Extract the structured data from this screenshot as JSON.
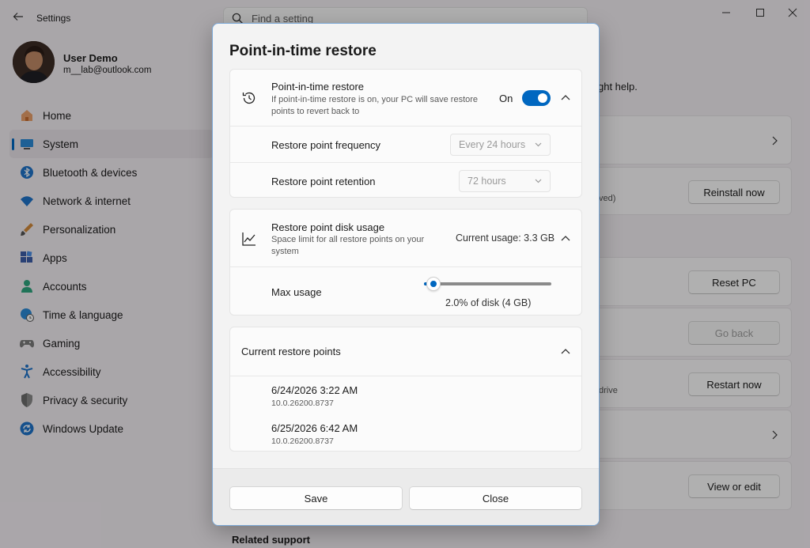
{
  "window": {
    "app_title": "Settings",
    "search_placeholder": "Find a setting"
  },
  "profile": {
    "name": "User Demo",
    "email": "m__lab@outlook.com"
  },
  "sidebar": {
    "items": [
      {
        "label": "Home",
        "icon": "home-icon"
      },
      {
        "label": "System",
        "icon": "system-icon",
        "active": true
      },
      {
        "label": "Bluetooth & devices",
        "icon": "bluetooth-icon"
      },
      {
        "label": "Network & internet",
        "icon": "wifi-icon"
      },
      {
        "label": "Personalization",
        "icon": "brush-icon"
      },
      {
        "label": "Apps",
        "icon": "apps-icon"
      },
      {
        "label": "Accounts",
        "icon": "accounts-icon"
      },
      {
        "label": "Time & language",
        "icon": "globe-clock-icon"
      },
      {
        "label": "Gaming",
        "icon": "gamepad-icon"
      },
      {
        "label": "Accessibility",
        "icon": "accessibility-icon"
      },
      {
        "label": "Privacy & security",
        "icon": "shield-icon"
      },
      {
        "label": "Windows Update",
        "icon": "update-icon"
      }
    ]
  },
  "background": {
    "help_fragment": "ght help.",
    "reinstall_sub_fragment": "ved)",
    "reinstall_button": "Reinstall now",
    "reset_button": "Reset PC",
    "goback_button": "Go back",
    "restart_sub_fragment": "drive",
    "restart_button": "Restart now",
    "view_button": "View or edit",
    "related_support": "Related support"
  },
  "dialog": {
    "title": "Point-in-time restore",
    "restore": {
      "title": "Point-in-time restore",
      "description": "If point-in-time restore is on, your PC will save restore points to revert back to",
      "toggle_label": "On",
      "toggle_on": true
    },
    "frequency": {
      "label": "Restore point frequency",
      "value": "Every 24 hours"
    },
    "retention": {
      "label": "Restore point retention",
      "value": "72 hours"
    },
    "disk": {
      "title": "Restore point disk usage",
      "description": "Space limit for all restore points on your system",
      "current": "Current usage: 3.3 GB"
    },
    "max_usage": {
      "label": "Max usage",
      "value_text": "2.0% of disk (4 GB)",
      "level_fraction": 0.02
    },
    "restore_points": {
      "header": "Current restore points",
      "items": [
        {
          "date": "6/24/2026 3:22 AM",
          "version": "10.0.26200.8737"
        },
        {
          "date": "6/25/2026 6:42 AM",
          "version": "10.0.26200.8737"
        }
      ]
    },
    "buttons": {
      "save": "Save",
      "close": "Close"
    }
  },
  "colors": {
    "accent": "#0067c0",
    "window_bg": "#f3eef3",
    "dialog_border": "#7aa7d6"
  }
}
